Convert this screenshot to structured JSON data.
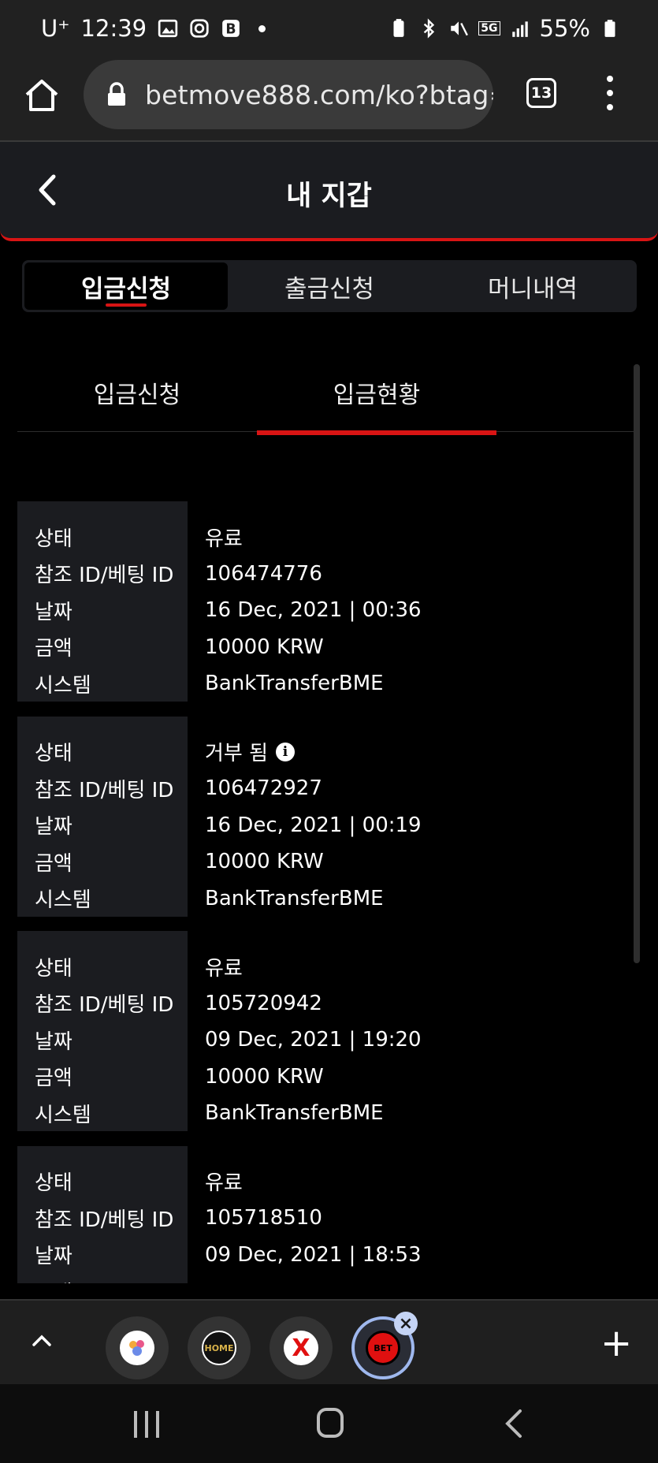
{
  "status_bar": {
    "carrier": "U⁺",
    "time": "12:39",
    "battery": "55%",
    "network": "5G"
  },
  "browser": {
    "url": "betmove888.com/ko?btag=",
    "tab_count": "13"
  },
  "header": {
    "title": "내 지갑"
  },
  "main_tabs": [
    {
      "label": "입금신청",
      "active": true
    },
    {
      "label": "출금신청",
      "active": false
    },
    {
      "label": "머니내역",
      "active": false
    }
  ],
  "sub_tabs": [
    {
      "label": "입금신청",
      "active": false
    },
    {
      "label": "입금현황",
      "active": true
    }
  ],
  "record_labels": {
    "status": "상태",
    "ref_id": "참조 ID/베팅 ID",
    "date": "날짜",
    "amount": "금액",
    "system": "시스템"
  },
  "records": [
    {
      "status": "유료",
      "ref_id": "106474776",
      "date": "16 Dec, 2021 | 00:36",
      "amount": "10000 KRW",
      "system": "BankTransferBME"
    },
    {
      "status": "거부 됨",
      "ref_id": "106472927",
      "date": "16 Dec, 2021 | 00:19",
      "amount": "10000 KRW",
      "system": "BankTransferBME"
    },
    {
      "status": "유료",
      "ref_id": "105720942",
      "date": "09 Dec, 2021 | 19:20",
      "amount": "10000 KRW",
      "system": "BankTransferBME"
    },
    {
      "status": "유료",
      "ref_id": "105718510",
      "date": "09 Dec, 2021 | 18:53",
      "amount": "",
      "system": ""
    }
  ],
  "tab_strip": {
    "thumb_texts": [
      "",
      "HOME",
      "X",
      "BET"
    ],
    "colors": {
      "accent": "#d81414",
      "active_ring": "#9fb8ee"
    }
  },
  "icons": {
    "info": "i",
    "plus": "+"
  }
}
